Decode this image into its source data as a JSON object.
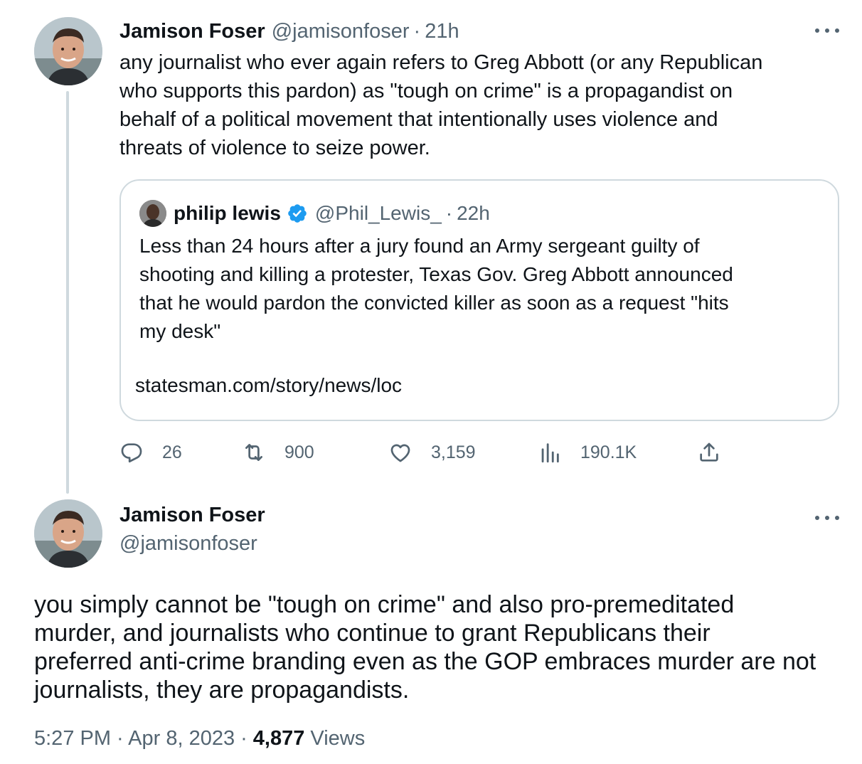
{
  "tweet1": {
    "display_name": "Jamison Foser",
    "handle": "@jamisonfoser",
    "separator": "·",
    "time": "21h",
    "text": "any journalist who ever again refers to Greg Abbott (or any Republican\nwho supports this pardon) as \"tough on crime\" is a propagandist on\nbehalf of a political movement that intentionally uses violence and\nthreats of violence to seize power.",
    "quote": {
      "display_name": "philip lewis",
      "verified": true,
      "handle": "@Phil_Lewis_",
      "separator": "·",
      "time": "22h",
      "text": "Less than 24 hours after a jury found an Army sergeant guilty of\nshooting and killing a protester, Texas Gov. Greg Abbott announced\nthat he would pardon the convicted killer as soon as a request \"hits\nmy desk\"",
      "link": "statesman.com/story/news/loc"
    },
    "actions": {
      "replies": "26",
      "retweets": "900",
      "likes": "3,159",
      "views": "190.1K"
    }
  },
  "tweet2": {
    "display_name": "Jamison Foser",
    "handle": "@jamisonfoser",
    "text": "you simply cannot be \"tough on crime\" and also pro-premeditated\nmurder, and journalists who continue to grant Republicans their\npreferred anti-crime branding even as the GOP embraces murder are not\njournalists, they are propagandists.",
    "timestamp": "5:27 PM · Apr 8, 2023",
    "separator": "·",
    "views_count": "4,877",
    "views_label": "Views"
  },
  "colors": {
    "text": "#0f1419",
    "muted": "#536471",
    "border": "#cfd9de",
    "verified": "#1d9bf0"
  },
  "icons": [
    "reply-icon",
    "retweet-icon",
    "like-icon",
    "views-icon",
    "share-icon",
    "more-icon",
    "verified-badge-icon"
  ]
}
